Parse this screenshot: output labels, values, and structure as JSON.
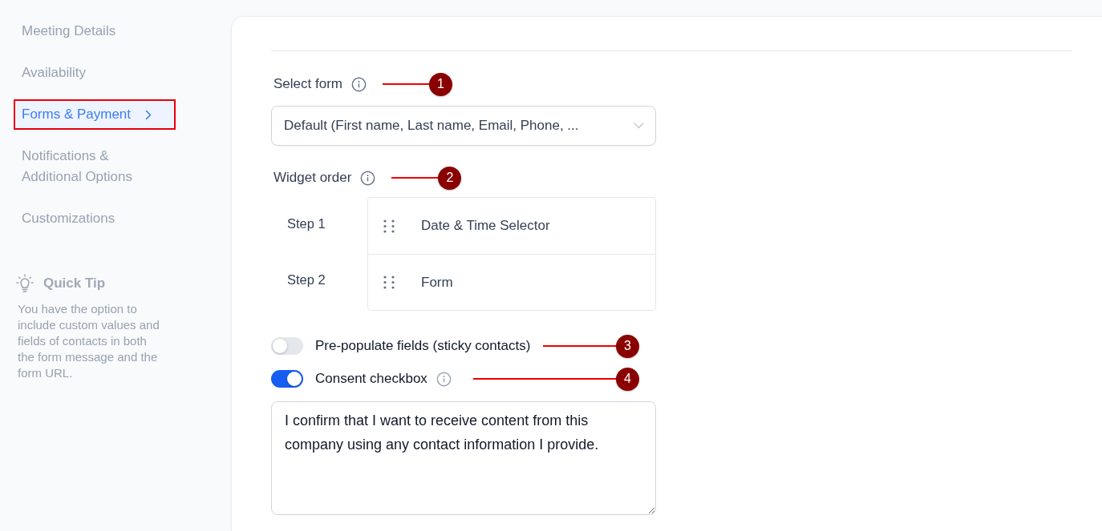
{
  "sidebar": {
    "items": [
      {
        "label": "Meeting Details",
        "selected": false,
        "highlighted": false
      },
      {
        "label": "Availability",
        "selected": false,
        "highlighted": false
      },
      {
        "label": "Forms & Payment",
        "selected": true,
        "highlighted": true
      },
      {
        "label": "Notifications & Additional Options",
        "selected": false,
        "highlighted": false
      },
      {
        "label": "Customizations",
        "selected": false,
        "highlighted": false
      }
    ],
    "quick_tip": {
      "title": "Quick Tip",
      "text": "You have the option to include custom values and fields of contacts in both the form message and the form URL."
    }
  },
  "select_form": {
    "label": "Select form",
    "info": true,
    "callout": "1",
    "value": "Default (First name, Last name, Email, Phone, ..."
  },
  "widget_order": {
    "label": "Widget order",
    "info": true,
    "callout": "2",
    "steps": [
      {
        "step": "Step 1",
        "widget": "Date & Time Selector"
      },
      {
        "step": "Step 2",
        "widget": "Form"
      }
    ]
  },
  "toggles": [
    {
      "label": "Pre-populate fields (sticky contacts)",
      "on": false,
      "info": false,
      "callout": "3"
    },
    {
      "label": "Consent checkbox",
      "on": true,
      "info": true,
      "callout": "4"
    }
  ],
  "consent_message": {
    "value": "I confirm that I want to receive content from this company using any contact information I provide."
  }
}
